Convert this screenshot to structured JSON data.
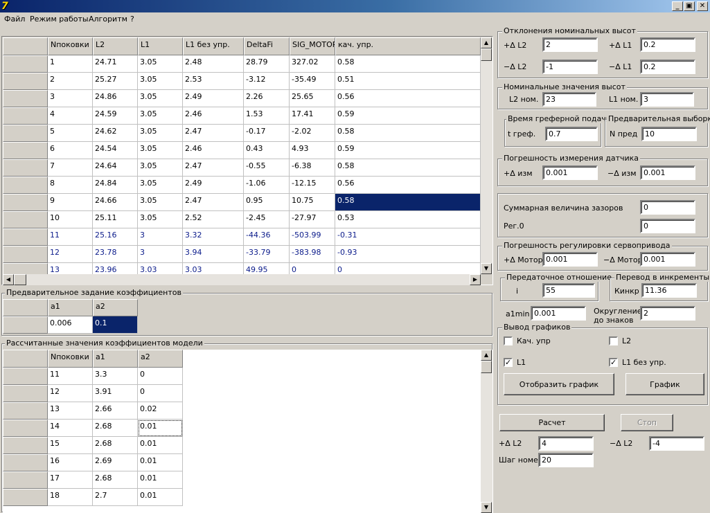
{
  "window": {
    "minimize": "_",
    "restore": "▣",
    "close": "✕"
  },
  "menu": [
    "Файл",
    "Режим работы",
    "Алгоритм",
    "?"
  ],
  "main_table": {
    "headers": [
      "Nпоковки",
      "L2",
      "L1",
      "L1 без упр.",
      "DeltaFi",
      "SIG_MOTOR",
      "кач. упр."
    ],
    "rows": [
      [
        "1",
        "24.71",
        "3.05",
        "2.48",
        "28.79",
        "327.02",
        "0.58"
      ],
      [
        "2",
        "25.27",
        "3.05",
        "2.53",
        "-3.12",
        "-35.49",
        "0.51"
      ],
      [
        "3",
        "24.86",
        "3.05",
        "2.49",
        "2.26",
        "25.65",
        "0.56"
      ],
      [
        "4",
        "24.59",
        "3.05",
        "2.46",
        "1.53",
        "17.41",
        "0.59"
      ],
      [
        "5",
        "24.62",
        "3.05",
        "2.47",
        "-0.17",
        "-2.02",
        "0.58"
      ],
      [
        "6",
        "24.54",
        "3.05",
        "2.46",
        "0.43",
        "4.93",
        "0.59"
      ],
      [
        "7",
        "24.64",
        "3.05",
        "2.47",
        "-0.55",
        "-6.38",
        "0.58"
      ],
      [
        "8",
        "24.84",
        "3.05",
        "2.49",
        "-1.06",
        "-12.15",
        "0.56"
      ],
      [
        "9",
        "24.66",
        "3.05",
        "2.47",
        "0.95",
        "10.75",
        "0.58"
      ],
      [
        "10",
        "25.11",
        "3.05",
        "2.52",
        "-2.45",
        "-27.97",
        "0.53"
      ],
      [
        "11",
        "25.16",
        "3",
        "3.32",
        "-44.36",
        "-503.99",
        "-0.31"
      ],
      [
        "12",
        "23.78",
        "3",
        "3.94",
        "-33.79",
        "-383.98",
        "-0.93"
      ],
      [
        "13",
        "23.96",
        "3.03",
        "3.03",
        "49.95",
        "0",
        "0"
      ]
    ]
  },
  "coef_preset": {
    "title": "Предварительное задание коэффициентов",
    "headers": [
      "a1",
      "a2"
    ],
    "values": [
      "0.006",
      "0.1"
    ]
  },
  "coef_calc": {
    "title": "Рассчитанные значения коэффициентов модели",
    "headers": [
      "Nпоковки",
      "a1",
      "a2"
    ],
    "rows": [
      [
        "11",
        "3.3",
        "0"
      ],
      [
        "12",
        "3.91",
        "0"
      ],
      [
        "13",
        "2.66",
        "0.02"
      ],
      [
        "14",
        "2.68",
        "0.01"
      ],
      [
        "15",
        "2.68",
        "0.01"
      ],
      [
        "16",
        "2.69",
        "0.01"
      ],
      [
        "17",
        "2.68",
        "0.01"
      ],
      [
        "18",
        "2.7",
        "0.01"
      ]
    ]
  },
  "dev": {
    "title": "Отклонения номинальных высот",
    "plus_l2_label": "+Δ L2",
    "plus_l2": "2",
    "plus_l1_label": "+Δ L1",
    "plus_l1": "0.2",
    "minus_l2_label": "−Δ L2",
    "minus_l2": "-1",
    "minus_l1_label": "−Δ L1",
    "minus_l1": "0.2"
  },
  "nominal": {
    "title": "Номинальные значения высот",
    "l2_label": "L2 ном.",
    "l2": "23",
    "l1_label": "L1 ном.",
    "l1": "3"
  },
  "feed": {
    "title": "Время греферной подачи",
    "label": "t греф.",
    "value": "0.7"
  },
  "presample": {
    "title": "Предварительная выборка",
    "label": "N пред",
    "value": "10"
  },
  "sensor": {
    "title": "Погрешность измерения датчика",
    "plus_label": "+Δ изм",
    "plus": "0.001",
    "minus_label": "−Δ изм",
    "minus": "0.001"
  },
  "gaps": {
    "sum_label": "Суммарная величина зазоров",
    "sum": "0",
    "reg_label": "Рег.0",
    "reg": "0"
  },
  "servo": {
    "title": "Погрешность регулировки сервопривода",
    "plus_label": "+Δ Мотор",
    "plus": "0.001",
    "minus_label": "−Δ Мотор",
    "minus": "0.001"
  },
  "ratio": {
    "title": "Передаточное отношение",
    "label": "i",
    "value": "55"
  },
  "incr": {
    "title": "Перевод в инкременты",
    "label": "Кинкр",
    "value": "11.36"
  },
  "a1min": {
    "label": "a1min",
    "value": "0.001"
  },
  "round": {
    "label1": "Округление",
    "label2": "до знаков",
    "value": "2"
  },
  "graphs": {
    "title": "Вывод графиков",
    "kach_label": "Кач. упр",
    "kach_checked": false,
    "l2_label": "L2",
    "l2_checked": false,
    "l1_label": "L1",
    "l1_checked": true,
    "l1bu_label": "L1 без упр.",
    "l1bu_checked": true,
    "show_btn": "Отобразить график",
    "graph_btn": "График"
  },
  "calc_btn": "Расчет",
  "stop_btn": "Стоп",
  "bottom": {
    "plus_l2_label": "+Δ L2",
    "plus_l2": "4",
    "minus_l2_label": "−Δ L2",
    "minus_l2": "-4",
    "step_label": "Шаг номер",
    "step": "20"
  },
  "icons": {
    "check": "✓"
  }
}
